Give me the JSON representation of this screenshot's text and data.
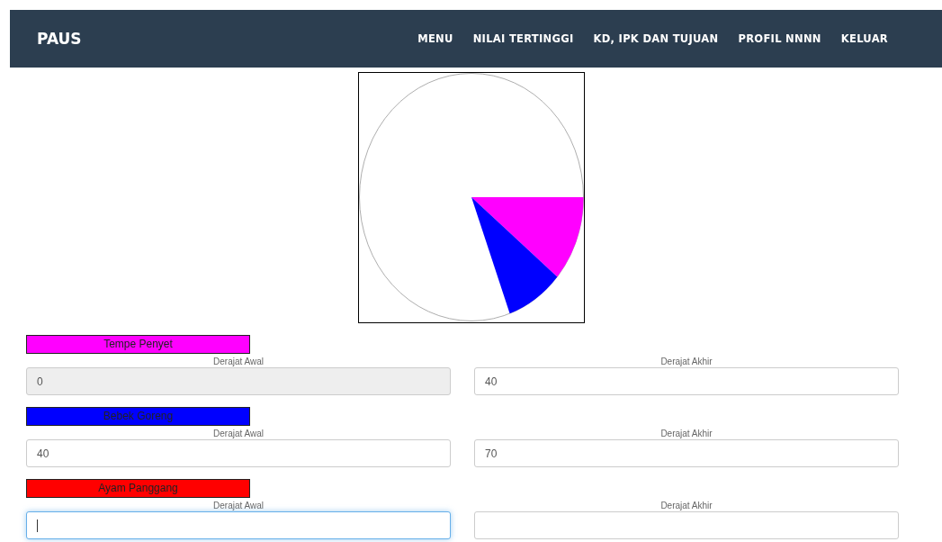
{
  "navbar": {
    "brand": "PAUS",
    "links": [
      "MENU",
      "NILAI TERTINGGI",
      "KD, IPK DAN TUJUAN",
      "PROFIL NNNN",
      "KELUAR"
    ]
  },
  "items": [
    {
      "name": "Tempe Penyet",
      "color": "#ff00ff",
      "start": {
        "label": "Derajat Awal",
        "value": "0",
        "disabled": true,
        "focused": false
      },
      "end": {
        "label": "Derajat Akhir",
        "value": "40",
        "disabled": false,
        "focused": false
      }
    },
    {
      "name": "Bebek Goreng",
      "color": "#0000ff",
      "start": {
        "label": "Derajat Awal",
        "value": "40",
        "disabled": false,
        "focused": false
      },
      "end": {
        "label": "Derajat Akhir",
        "value": "70",
        "disabled": false,
        "focused": false
      }
    },
    {
      "name": "Ayam Panggang",
      "color": "#ff0000",
      "start": {
        "label": "Derajat Awal",
        "disabled": false,
        "focused": true
      },
      "end": {
        "label": "Derajat Akhir",
        "disabled": false,
        "focused": false
      }
    }
  ]
}
